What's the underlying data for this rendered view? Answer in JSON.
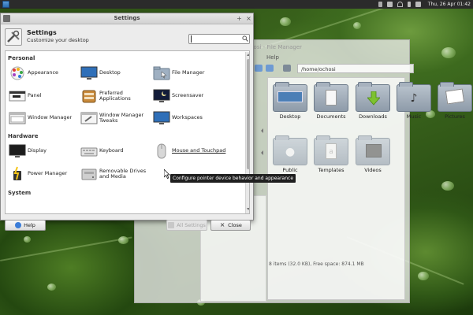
{
  "top_panel": {
    "clock": "Thu, 26 Apr  01:42"
  },
  "file_manager": {
    "title": "ochosi - File Manager",
    "menu_help": "Help",
    "location": "/home/ochosi",
    "status": "8 items (32.0 KB), Free space: 874.1 MB",
    "folders": [
      {
        "label": "Desktop",
        "icon": "desktop-folder-icon"
      },
      {
        "label": "Documents",
        "icon": "documents-folder-icon"
      },
      {
        "label": "Downloads",
        "icon": "downloads-folder-icon"
      },
      {
        "label": "Music",
        "icon": "music-folder-icon"
      },
      {
        "label": "Pictures",
        "icon": "pictures-folder-icon"
      },
      {
        "label": "Public",
        "icon": "public-folder-icon"
      },
      {
        "label": "Templates",
        "icon": "templates-folder-icon"
      },
      {
        "label": "Videos",
        "icon": "videos-folder-icon"
      }
    ]
  },
  "settings": {
    "window_title": "Settings",
    "header_title": "Settings",
    "header_subtitle": "Customize your desktop",
    "search_value": "",
    "categories": {
      "personal": "Personal",
      "hardware": "Hardware",
      "system": "System"
    },
    "personal_items": [
      {
        "label": "Appearance",
        "icon": "appearance-icon"
      },
      {
        "label": "Desktop",
        "icon": "desktop-icon"
      },
      {
        "label": "File Manager",
        "icon": "file-manager-icon"
      },
      {
        "label": "Panel",
        "icon": "panel-icon"
      },
      {
        "label": "Preferred Applications",
        "icon": "preferred-applications-icon"
      },
      {
        "label": "Screensaver",
        "icon": "screensaver-icon"
      },
      {
        "label": "Window Manager",
        "icon": "window-manager-icon"
      },
      {
        "label": "Window Manager Tweaks",
        "icon": "window-manager-tweaks-icon"
      },
      {
        "label": "Workspaces",
        "icon": "workspaces-icon"
      }
    ],
    "hardware_items": [
      {
        "label": "Display",
        "icon": "display-icon"
      },
      {
        "label": "Keyboard",
        "icon": "keyboard-icon"
      },
      {
        "label": "Mouse and Touchpad",
        "icon": "mouse-icon"
      },
      {
        "label": "Power Manager",
        "icon": "power-manager-icon"
      },
      {
        "label": "Removable Drives and Media",
        "icon": "removable-drives-icon"
      }
    ],
    "tooltip": "Configure pointer device behavior and appearance",
    "buttons": {
      "help": "Help",
      "all_settings": "All Settings",
      "close": "Close"
    }
  },
  "colors": {
    "accent_blue": "#3b7dd8",
    "tooltip_bg": "#1f1f1f",
    "panel_bg": "#2b2b2b"
  }
}
